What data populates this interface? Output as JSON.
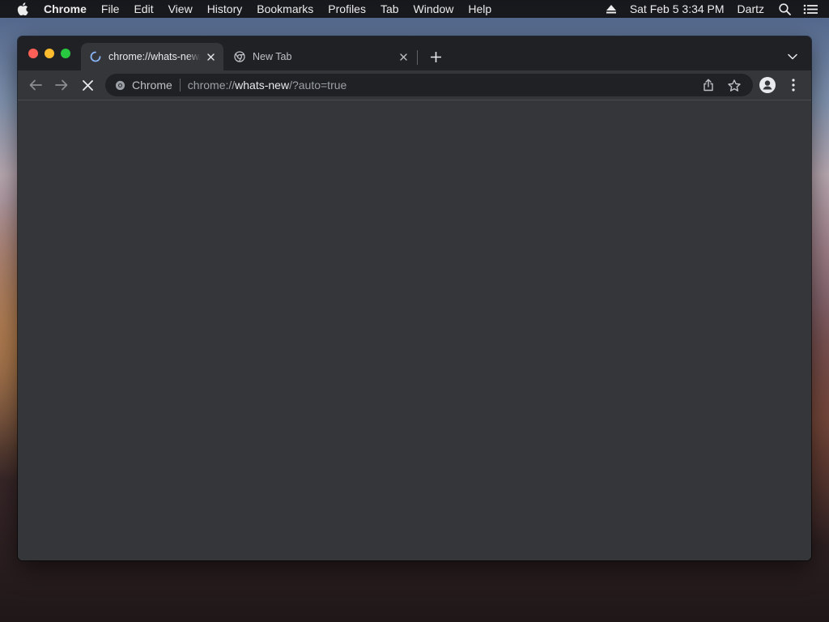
{
  "menubar": {
    "app_name": "Chrome",
    "items": [
      "File",
      "Edit",
      "View",
      "History",
      "Bookmarks",
      "Profiles",
      "Tab",
      "Window",
      "Help"
    ],
    "datetime": "Sat Feb 5  3:34 PM",
    "user": "Dartz"
  },
  "tabs": [
    {
      "title": "chrome://whats-new/?auto=true",
      "active": true,
      "loading": true
    },
    {
      "title": "New Tab",
      "active": false,
      "loading": false
    }
  ],
  "omnibox": {
    "chip_label": "Chrome",
    "url_scheme": "chrome://",
    "url_host": "whats-new",
    "url_rest": "/?auto=true"
  },
  "icons": {
    "apple": "apple-logo-icon",
    "eject": "eject-icon",
    "search": "spotlight-search-icon",
    "control_center": "control-center-icon",
    "tab_close": "close-icon",
    "new_tab": "plus-icon",
    "tab_search": "chevron-down-icon",
    "back": "arrow-left-icon",
    "forward": "arrow-right-icon",
    "stop": "stop-icon",
    "share": "share-icon",
    "bookmark": "star-icon",
    "profile": "person-icon",
    "menu": "kebab-menu-icon"
  },
  "colors": {
    "window_bg": "#35363a",
    "tabstrip_bg": "#202124",
    "omnibox_bg": "#202124",
    "text_primary": "#e8eaed",
    "text_secondary": "#9aa0a6",
    "traffic_close": "#fe5f57",
    "traffic_minimize": "#febc2e",
    "traffic_maximize": "#28c840",
    "spinner": "#8ab4f8"
  }
}
